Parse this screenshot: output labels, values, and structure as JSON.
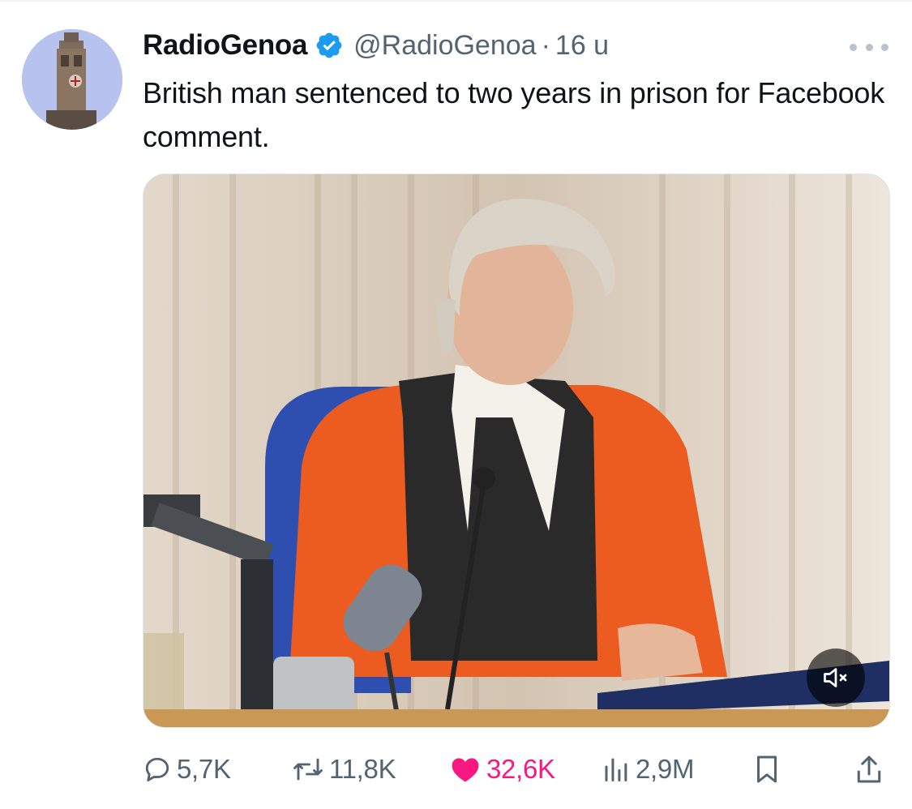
{
  "tweet": {
    "display_name": "RadioGenoa",
    "handle": "@RadioGenoa",
    "separator": "·",
    "time": "16 u",
    "text": "British man sentenced to two years in prison for Facebook comment."
  },
  "actions": {
    "replies": "5,7K",
    "reposts": "11,8K",
    "likes": "32,6K",
    "views": "2,9M"
  },
  "colors": {
    "verified_badge": "#1d9bf0",
    "like_active": "#f91880",
    "muted_text": "#536471"
  },
  "icons": [
    "avatar-tower",
    "verified-badge-icon",
    "more-icon",
    "speaker-muted-icon",
    "reply-icon",
    "repost-icon",
    "heart-icon",
    "views-icon",
    "bookmark-icon",
    "share-icon"
  ]
}
